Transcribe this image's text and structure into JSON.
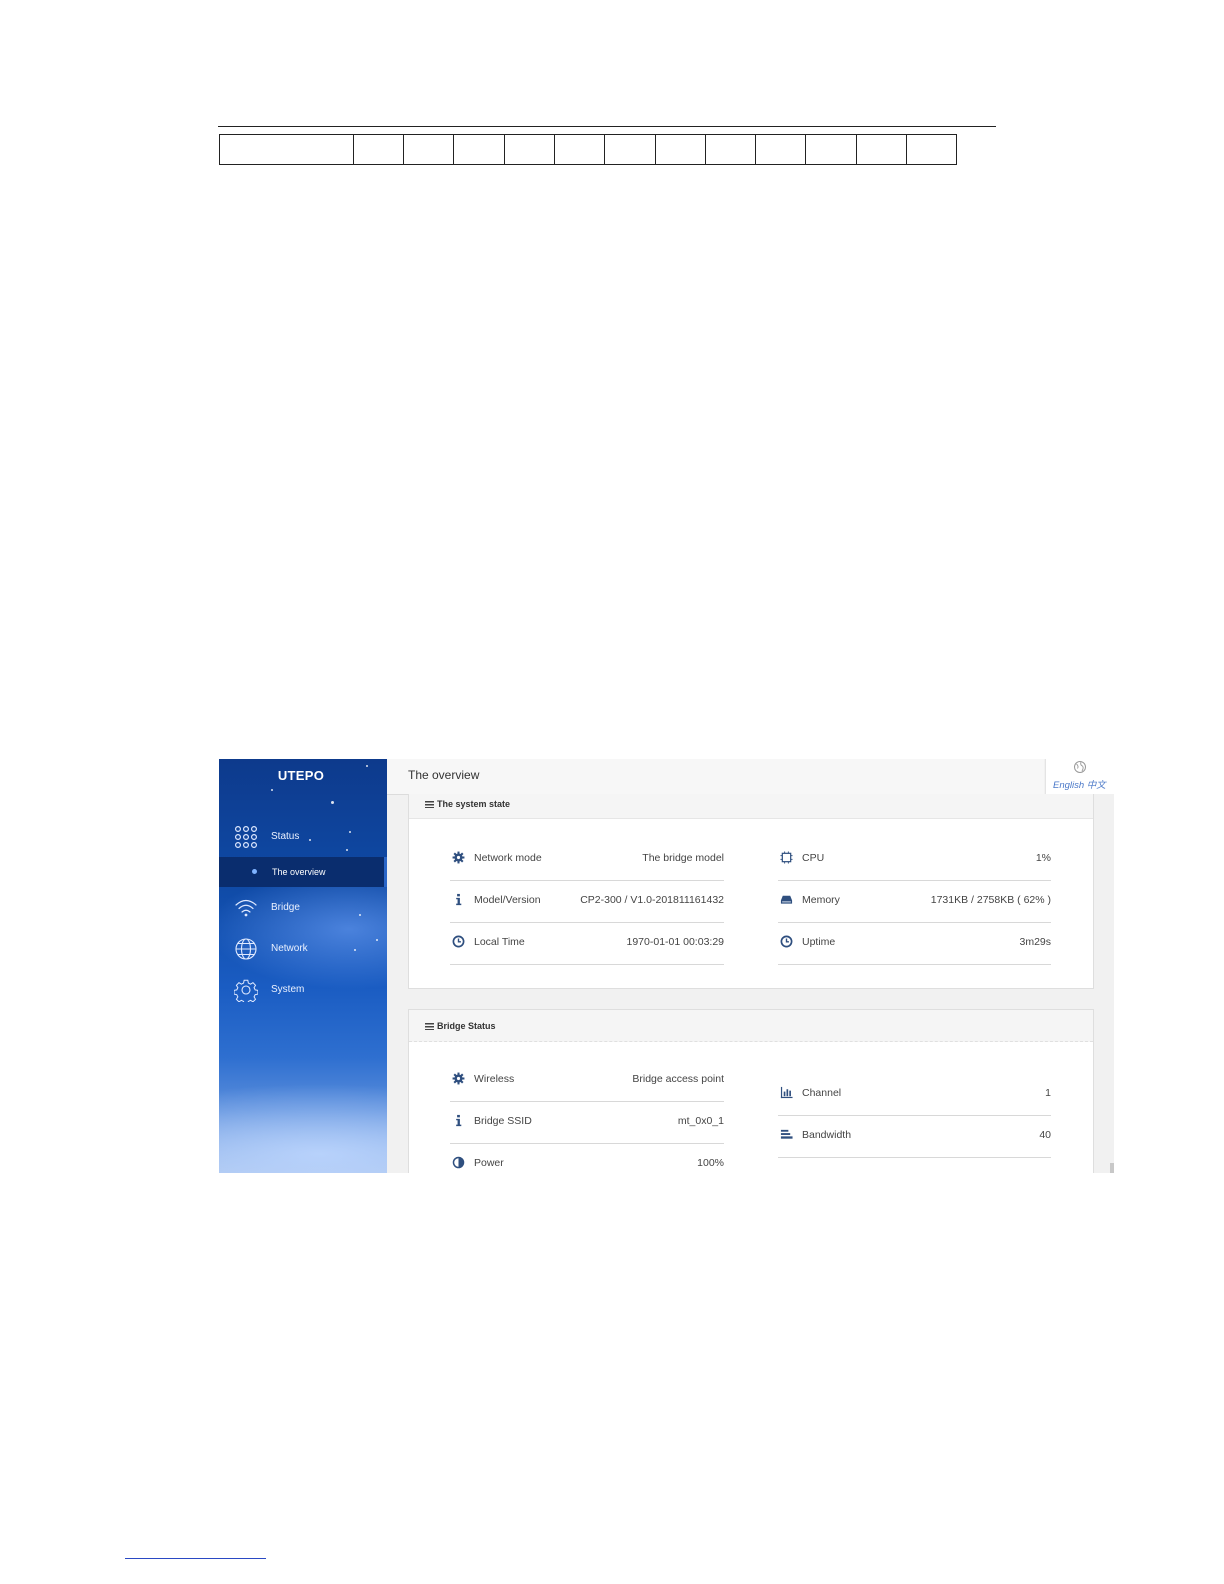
{
  "sidebar": {
    "logo": "UTEPO",
    "items": [
      {
        "label": "Status"
      },
      {
        "label": "The overview"
      },
      {
        "label": "Bridge"
      },
      {
        "label": "Network"
      },
      {
        "label": "System"
      }
    ]
  },
  "header": {
    "title": "The overview",
    "lang_label": "English 中文"
  },
  "system_state": {
    "title": "The system state",
    "left": [
      {
        "icon": "gear-icon",
        "label": "Network mode",
        "value": "The bridge model"
      },
      {
        "icon": "info-icon",
        "label": "Model/Version",
        "value": "CP2-300 / V1.0-201811161432"
      },
      {
        "icon": "clock-icon",
        "label": "Local Time",
        "value": "1970-01-01 00:03:29"
      }
    ],
    "right": [
      {
        "icon": "cpu-icon",
        "label": "CPU",
        "value": "1%"
      },
      {
        "icon": "memory-icon",
        "label": "Memory",
        "value": "1731KB / 2758KB ( 62% )"
      },
      {
        "icon": "clock-icon",
        "label": "Uptime",
        "value": "3m29s"
      }
    ]
  },
  "bridge_status": {
    "title": "Bridge Status",
    "left": [
      {
        "icon": "gear-icon",
        "label": "Wireless",
        "value": "Bridge access point"
      },
      {
        "icon": "info-icon",
        "label": "Bridge SSID",
        "value": "mt_0x0_1"
      },
      {
        "icon": "contrast-icon",
        "label": "Power",
        "value": "100%"
      }
    ],
    "right": [
      {
        "icon": "bar-chart-icon",
        "label": "Channel",
        "value": "1"
      },
      {
        "icon": "bandwidth-icon",
        "label": "Bandwidth",
        "value": "40"
      }
    ]
  },
  "colors": {
    "sidebar_dark": "#0d3a8c",
    "accent": "#4a78c8",
    "icon": "#2f4f7f"
  }
}
